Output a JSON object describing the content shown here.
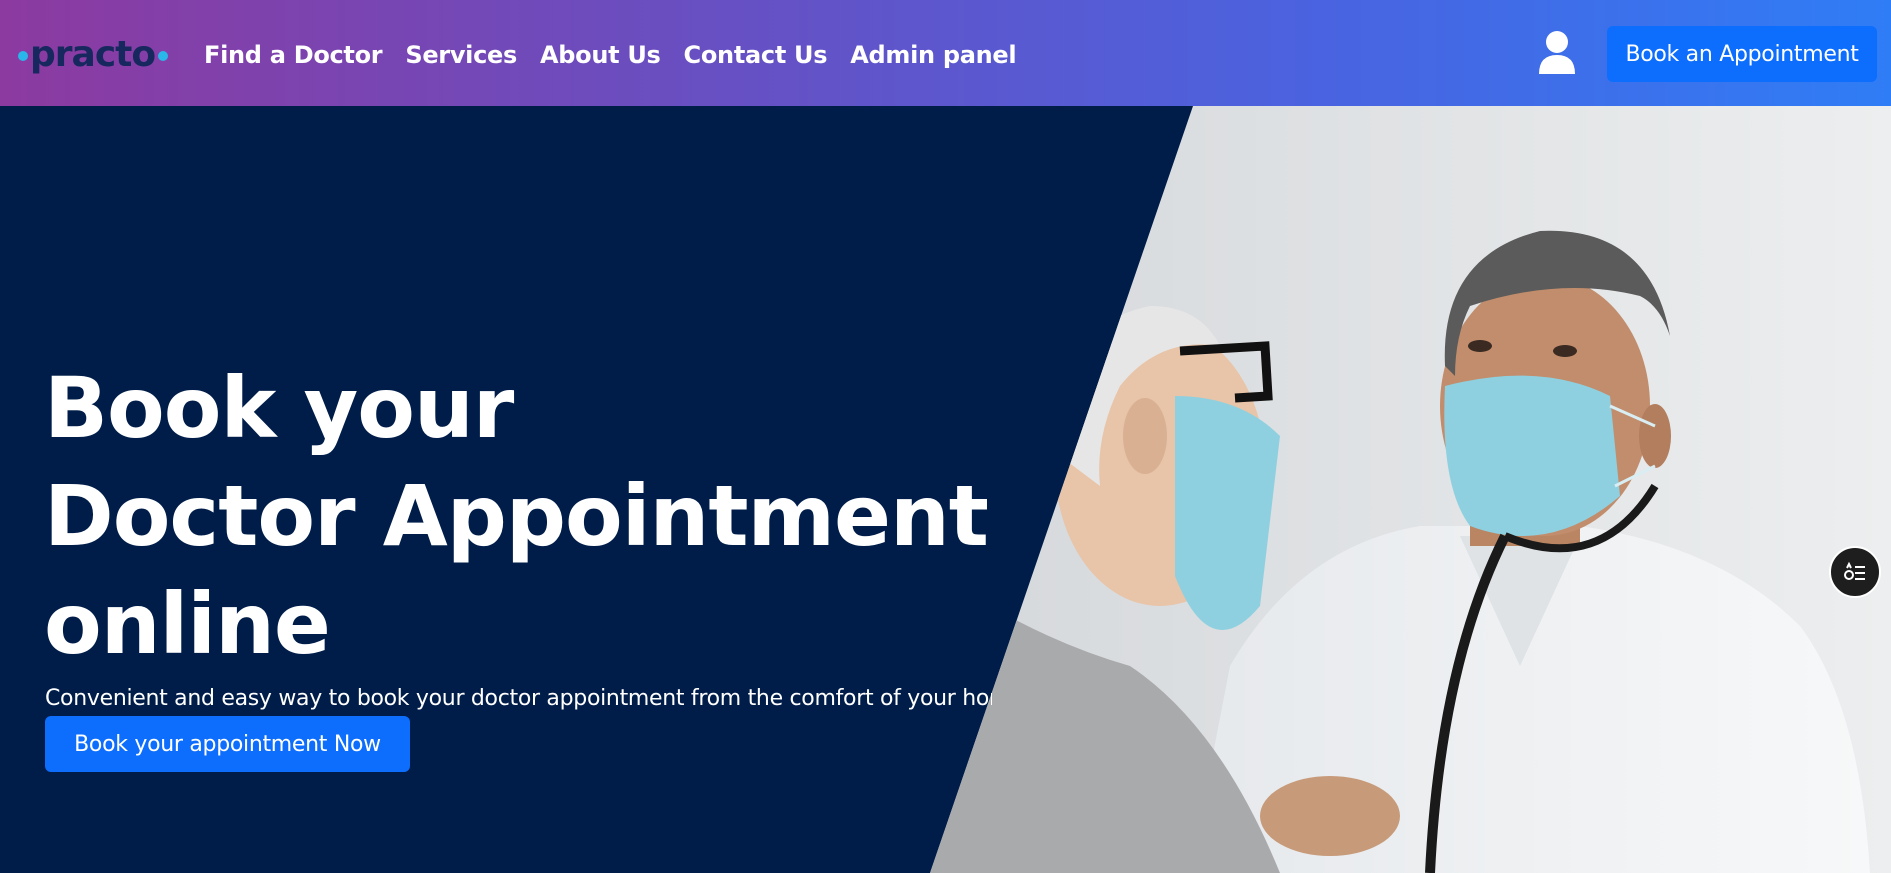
{
  "brand": {
    "logo_text": "practo",
    "dot_color": "#29b6e8",
    "text_color": "#16285e"
  },
  "nav": {
    "links": [
      {
        "label": "Find a Doctor"
      },
      {
        "label": "Services"
      },
      {
        "label": "About Us"
      },
      {
        "label": "Contact Us"
      },
      {
        "label": "Admin panel"
      }
    ],
    "user_icon": "user-icon",
    "cta_label": "Book an Appointment"
  },
  "hero": {
    "title_lines": [
      "Book your",
      "Doctor Appointment",
      "online"
    ],
    "subtitle": "Convenient and easy way to book your doctor appointment from the comfort of your home",
    "button_label": "Book your appointment Now",
    "background_color": "#001d4a",
    "image": "doctor-patient-photo"
  },
  "floating_button": {
    "icon": "options-list-icon"
  },
  "colors": {
    "primary": "#0d6efd",
    "nav_gradient_start": "#8c3aa0",
    "nav_gradient_end": "#2f7df6"
  }
}
